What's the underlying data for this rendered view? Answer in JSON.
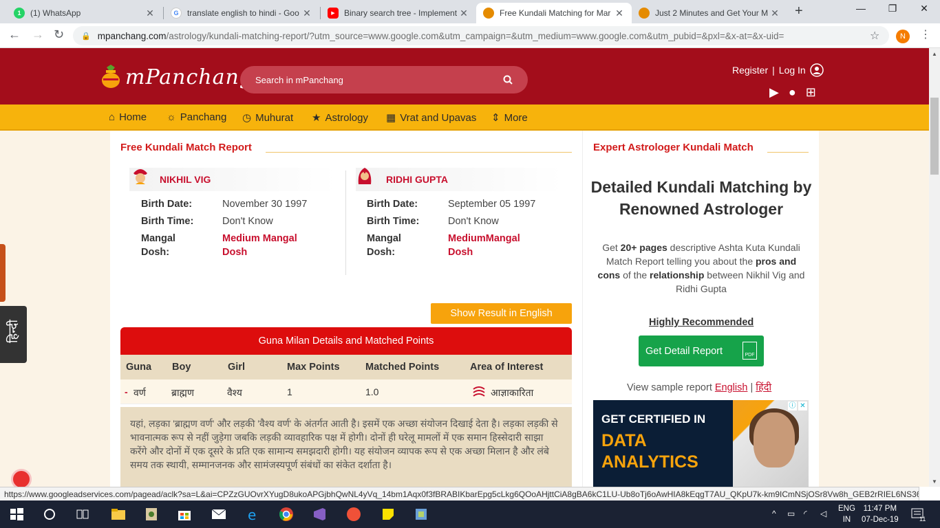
{
  "browser": {
    "tabs": [
      {
        "title": "(1) WhatsApp",
        "icon": "whatsapp-icon",
        "color": "#25d366",
        "glyph": "1"
      },
      {
        "title": "translate english to hindi - Goo",
        "icon": "google-icon",
        "color": "#4285f4",
        "glyph": "G"
      },
      {
        "title": "Binary search tree - Implement",
        "icon": "youtube-icon",
        "color": "#ff0000",
        "glyph": "▶"
      },
      {
        "title": "Free Kundali Matching for Mar",
        "icon": "mpanchang-icon",
        "color": "#e58b00",
        "glyph": "◆"
      },
      {
        "title": "Just 2 Minutes and Get Your M",
        "icon": "mpanchang-icon",
        "color": "#e58b00",
        "glyph": "◆"
      }
    ],
    "url_host": "mpanchang.com",
    "url_path": "/astrology/kundali-matching-report/?utm_source=www.google.com&utm_campaign=&utm_medium=www.google.com&utm_pubid=&pxl=&x-at=&x-uid=",
    "profile_initial": "N",
    "status_url": "https://www.googleadservices.com/pagead/aclk?sa=L&ai=CPZzGUOvrXYugD8ukoAPGjbhQwNL4yVq_14bm1Aqx0f3fBRABIKbarEpg5cLkg6QOoAHjttCiA8gBA6kC1LU-Ub8oTj6oAwHIA8kEqgT7AU_QKpU7k-km9ICmNSjOSr8Vw8h_GEB2rRIEL6NS3676pj..."
  },
  "header": {
    "logo_text": "mPanchang",
    "search_placeholder": "Search in mPanchang",
    "register": "Register",
    "separator": "|",
    "login": "Log In"
  },
  "menu": {
    "home": "Home",
    "panchang": "Panchang",
    "muhurat": "Muhurat",
    "astrology": "Astrology",
    "vrat": "Vrat and Upavas",
    "more": "More"
  },
  "report": {
    "title": "Free Kundali Match Report",
    "boy": {
      "name": "NIKHIL VIG",
      "birth_date_label": "Birth Date:",
      "birth_date": "November 30 1997",
      "birth_time_label": "Birth Time:",
      "birth_time": "Don't Know",
      "mangal_label_1": "Mangal",
      "mangal_label_2": "Dosh:",
      "mangal_1": "Medium Mangal",
      "mangal_2": "Dosh"
    },
    "girl": {
      "name": "RIDHI GUPTA",
      "birth_date_label": "Birth Date:",
      "birth_date": "September 05 1997",
      "birth_time_label": "Birth Time:",
      "birth_time": "Don't Know",
      "mangal_label_1": "Mangal",
      "mangal_label_2": "Dosh:",
      "mangal_1": "MediumMangal",
      "mangal_2": "Dosh"
    },
    "show_english": "Show Result in English",
    "guna_header": "Guna Milan Details and Matched Points",
    "columns": {
      "guna": "Guna",
      "boy": "Boy",
      "girl": "Girl",
      "max": "Max Points",
      "matched": "Matched Points",
      "area": "Area of Interest"
    },
    "row": {
      "toggle": "-",
      "guna": "वर्ण",
      "boy": "ब्राह्मण",
      "girl": "वैश्य",
      "max": "1",
      "matched": "1.0",
      "area": "आज्ञाकारिता"
    },
    "description": "यहां, लड़का 'ब्राह्मण वर्ण' और लड़की 'वैश्य वर्ण' के अंतर्गत आती है। इसमें एक अच्छा संयोजन दिखाई देता है। लड़का लड़की से भावनात्मक रूप से नहीं जुड़ेगा जबकि लड़की व्यावहारिक पक्ष में होगी। दोनों ही घरेलू मामलों में एक समान हिस्सेदारी साझा करेंगे और दोनों में एक दूसरे के प्रति एक सामान्य समझदारी होगी। यह संयोजन व्यापक रूप से एक अच्छा मिलान है और लंबे समय तक स्थायी, सम्मानजनक और सामंजस्यपूर्ण संबंधों का संकेत दर्शाता है।"
  },
  "sidebar": {
    "title": "Expert Astrologer Kundali Match",
    "heading": "Detailed Kundali Matching by Renowned Astrologer",
    "p_get": "Get ",
    "p_pages": "20+ pages",
    "p_mid1": " descriptive Ashta Kuta Kundali Match Report telling you about the ",
    "p_pros": "pros and cons",
    "p_mid2": " of the ",
    "p_rel": "relationship",
    "p_end": " between Nikhil Vig and Ridhi Gupta",
    "recommended": "Highly Recommended",
    "button": "Get Detail Report",
    "pdf": "PDF",
    "sample_prefix": "View sample report ",
    "sample_en": "English",
    "sample_sep": " | ",
    "sample_hi": "हिंदी",
    "ad_line1": "GET CERTIFIED IN",
    "ad_line2": "DATA",
    "ad_line3": "ANALYTICS"
  },
  "lang_tab": "हिन्दी",
  "taskbar": {
    "lang_1": "ENG",
    "lang_2": "IN",
    "time": "11:47 PM",
    "date": "07-Dec-19",
    "notifications": "11"
  }
}
